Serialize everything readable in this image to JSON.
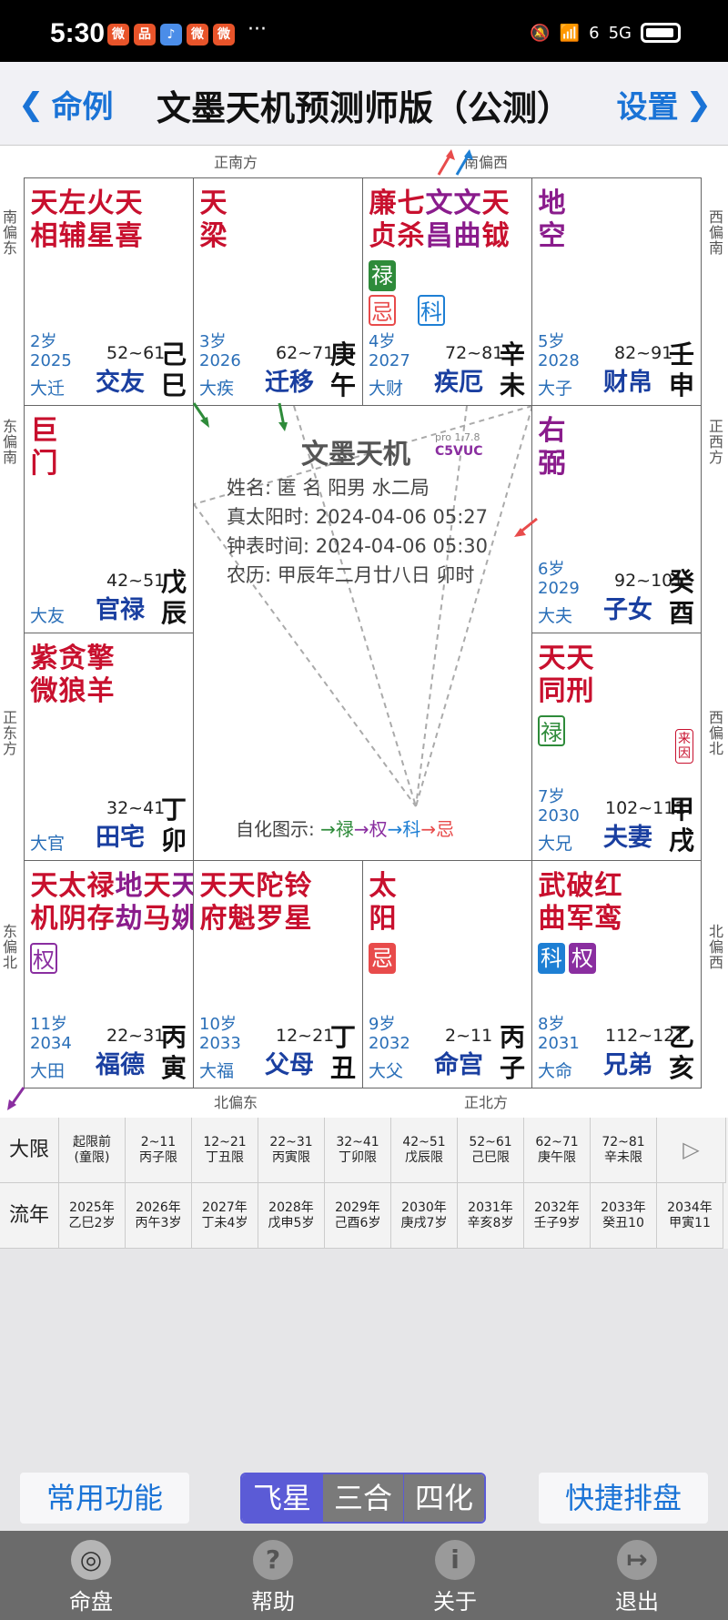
{
  "status": {
    "time": "5:30",
    "app_icons": [
      "微",
      "品",
      "♪",
      "微",
      "微"
    ],
    "more": "···",
    "net": "6",
    "gen": "5G"
  },
  "nav": {
    "back_label": "命例",
    "title": "文墨天机预测师版（公测）",
    "settings_label": "设置"
  },
  "directions": {
    "top_left": "正南方",
    "top_right": "南偏西",
    "bottom_left": "北偏东",
    "bottom_right": "正北方",
    "left": [
      "南偏东",
      "东偏南",
      "正东方",
      "东偏北"
    ],
    "right": [
      "西偏南",
      "正西方",
      "西偏北",
      "北偏西"
    ]
  },
  "palaces": [
    {
      "stars": [
        {
          "t": "天\n相",
          "c": "red"
        },
        {
          "t": "左\n辅",
          "c": "red"
        },
        {
          "t": "火\n星",
          "c": "red"
        },
        {
          "t": "天\n喜",
          "c": "red"
        }
      ],
      "badges": [],
      "age": "2岁",
      "year": "2025",
      "dx": "大迁",
      "range": "52~61",
      "name": "交友",
      "gz": "己\n巳"
    },
    {
      "stars": [
        {
          "t": "天\n梁",
          "c": "red"
        }
      ],
      "badges": [],
      "age": "3岁",
      "year": "2026",
      "dx": "大疾",
      "range": "62~71",
      "name": "迁移",
      "gz": "庚\n午"
    },
    {
      "stars": [
        {
          "t": "廉\n贞",
          "c": "red"
        },
        {
          "t": "七\n杀",
          "c": "red"
        },
        {
          "t": "文\n昌",
          "c": "purple"
        },
        {
          "t": "文\n曲",
          "c": "purple"
        },
        {
          "t": "天\n钺",
          "c": "red"
        }
      ],
      "badges": [
        {
          "t": "禄",
          "k": "lu-solid"
        },
        {
          "t": "忌",
          "k": "ji-out"
        },
        {
          "t": "科",
          "k": "ke-out"
        }
      ],
      "age": "4岁",
      "year": "2027",
      "dx": "大财",
      "range": "72~81",
      "name": "疾厄",
      "gz": "辛\n未"
    },
    {
      "stars": [
        {
          "t": "地\n空",
          "c": "purple"
        }
      ],
      "badges": [],
      "age": "5岁",
      "year": "2028",
      "dx": "大子",
      "range": "82~91",
      "name": "财帛",
      "gz": "壬\n申"
    },
    {
      "stars": [
        {
          "t": "巨\n门",
          "c": "red"
        }
      ],
      "badges": [],
      "age": "",
      "year": "",
      "dx": "大友",
      "range": "42~51",
      "name": "官禄",
      "gz": "戊\n辰"
    },
    {
      "stars": [
        {
          "t": "右\n弼",
          "c": "purple"
        }
      ],
      "badges": [],
      "age": "6岁",
      "year": "2029",
      "dx": "大夫",
      "range": "92~101",
      "name": "子女",
      "gz": "癸\n酉"
    },
    {
      "stars": [
        {
          "t": "紫\n微",
          "c": "red"
        },
        {
          "t": "贪\n狼",
          "c": "red"
        },
        {
          "t": "擎\n羊",
          "c": "red"
        }
      ],
      "badges": [],
      "age": "",
      "year": "",
      "dx": "大官",
      "range": "32~41",
      "name": "田宅",
      "gz": "丁\n卯"
    },
    {
      "stars": [
        {
          "t": "天\n同",
          "c": "red"
        },
        {
          "t": "天\n刑",
          "c": "red"
        }
      ],
      "badges": [
        {
          "t": "禄",
          "k": "lu-out"
        }
      ],
      "laiyin": "来因",
      "age": "7岁",
      "year": "2030",
      "dx": "大兄",
      "range": "102~111",
      "name": "夫妻",
      "gz": "甲\n戌"
    },
    {
      "stars": [
        {
          "t": "天\n机",
          "c": "red"
        },
        {
          "t": "太\n阴",
          "c": "red"
        },
        {
          "t": "禄\n存",
          "c": "red"
        },
        {
          "t": "地\n劫",
          "c": "purple"
        },
        {
          "t": "天\n马",
          "c": "red"
        },
        {
          "t": "天\n姚",
          "c": "purple"
        }
      ],
      "badges": [
        {
          "t": "权",
          "k": "quan-out"
        }
      ],
      "age": "11岁",
      "year": "2034",
      "dx": "大田",
      "range": "22~31",
      "name": "福德",
      "gz": "丙\n寅"
    },
    {
      "stars": [
        {
          "t": "天\n府",
          "c": "red"
        },
        {
          "t": "天\n魁",
          "c": "red"
        },
        {
          "t": "陀\n罗",
          "c": "red"
        },
        {
          "t": "铃\n星",
          "c": "red"
        }
      ],
      "badges": [],
      "age": "10岁",
      "year": "2033",
      "dx": "大福",
      "range": "12~21",
      "name": "父母",
      "gz": "丁\n丑"
    },
    {
      "stars": [
        {
          "t": "太\n阳",
          "c": "red"
        }
      ],
      "badges": [
        {
          "t": "忌",
          "k": "ji-solid"
        }
      ],
      "age": "9岁",
      "year": "2032",
      "dx": "大父",
      "range": "2~11",
      "name": "命宫",
      "gz": "丙\n子"
    },
    {
      "stars": [
        {
          "t": "武\n曲",
          "c": "red"
        },
        {
          "t": "破\n军",
          "c": "red"
        },
        {
          "t": "红\n鸾",
          "c": "red"
        }
      ],
      "badges": [
        {
          "t": "科",
          "k": "ke-solid"
        },
        {
          "t": "权",
          "k": "quan-solid"
        }
      ],
      "age": "8岁",
      "year": "2031",
      "dx": "大命",
      "range": "112~121",
      "name": "兄弟",
      "gz": "乙\n亥"
    }
  ],
  "center": {
    "logo": "文墨天机",
    "version": "pro 1.7.8",
    "code": "C5VUC",
    "name_line": "姓名: 匿 名           阳男 水二局",
    "solar_line": "真太阳时: 2024-04-06 05:27",
    "clock_line": "钟表时间: 2024-04-06 05:30",
    "lunar_line": "农历: 甲辰年二月廿八日 卯时",
    "legend_label": "自化图示:",
    "legend": [
      {
        "t": "→禄",
        "c": "#2e8b3a"
      },
      {
        "t": "→权",
        "c": "#8a2ea0"
      },
      {
        "t": "→科",
        "c": "#1e7fd4"
      },
      {
        "t": "→忌",
        "c": "#e84b4b"
      }
    ]
  },
  "daxian_row": {
    "label": "大限",
    "cells": [
      [
        "起限前",
        "(童限)"
      ],
      [
        "2~11",
        "丙子限"
      ],
      [
        "12~21",
        "丁丑限"
      ],
      [
        "22~31",
        "丙寅限"
      ],
      [
        "32~41",
        "丁卯限"
      ],
      [
        "42~51",
        "戊辰限"
      ],
      [
        "52~61",
        "己巳限"
      ],
      [
        "62~71",
        "庚午限"
      ],
      [
        "72~81",
        "辛未限"
      ]
    ],
    "next": "▷"
  },
  "liunian_row": {
    "label": "流年",
    "cells": [
      [
        "2025年",
        "乙巳2岁"
      ],
      [
        "2026年",
        "丙午3岁"
      ],
      [
        "2027年",
        "丁未4岁"
      ],
      [
        "2028年",
        "戊申5岁"
      ],
      [
        "2029年",
        "己酉6岁"
      ],
      [
        "2030年",
        "庚戌7岁"
      ],
      [
        "2031年",
        "辛亥8岁"
      ],
      [
        "2032年",
        "壬子9岁"
      ],
      [
        "2033年",
        "癸丑10"
      ],
      [
        "2034年",
        "甲寅11"
      ]
    ]
  },
  "tools": {
    "common": "常用功能",
    "seg": [
      "飞星",
      "三合",
      "四化"
    ],
    "quick": "快捷排盘"
  },
  "tabs": [
    "命盘",
    "帮助",
    "关于",
    "退出"
  ],
  "tab_icons": [
    "◎",
    "?",
    "i",
    "↦"
  ]
}
